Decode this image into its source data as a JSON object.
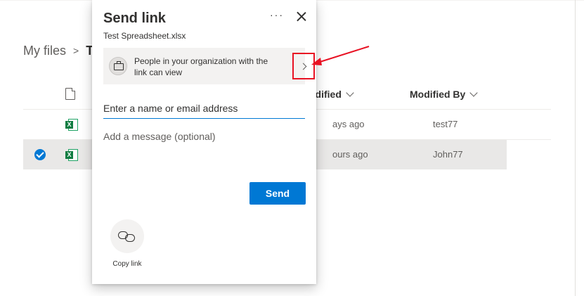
{
  "breadcrumb": {
    "root": "My files",
    "current": "T"
  },
  "list": {
    "columns": {
      "modified": "odified",
      "modified_by": "Modified By"
    },
    "rows": [
      {
        "modified": "ays ago",
        "modified_by": "test77",
        "selected": false
      },
      {
        "modified": "ours ago",
        "modified_by": "John77",
        "selected": true
      }
    ]
  },
  "dialog": {
    "title": "Send link",
    "more_label": "···",
    "file_name": "Test Spreadsheet.xlsx",
    "permission_text": "People in your organization with the link can view",
    "email_placeholder": "Enter a name or email address",
    "message_placeholder": "Add a message (optional)",
    "send_label": "Send",
    "copy_link_label": "Copy link"
  },
  "colors": {
    "accent": "#0078d4",
    "annotation": "#e81123",
    "excel": "#107c41"
  },
  "icons": [
    "ellipsis-icon",
    "close-icon",
    "briefcase-icon",
    "chevron-right-icon",
    "link-icon",
    "excel-file-icon",
    "document-icon",
    "checkmark-icon",
    "chevron-down-icon"
  ]
}
